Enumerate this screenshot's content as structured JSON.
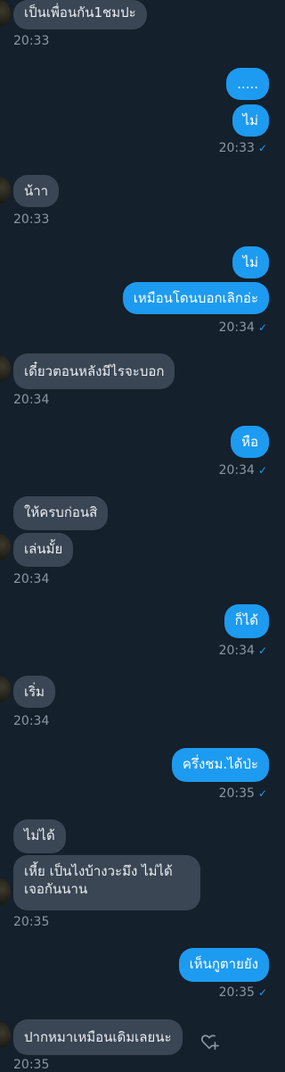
{
  "messages": [
    {
      "text": "เป็นเพื่อนกัน1ชมปะ"
    },
    {
      "text": "....."
    },
    {
      "text": "ไม่"
    },
    {
      "text": "น้าา"
    },
    {
      "text": "ไม่"
    },
    {
      "text": "เหมือนโดนบอกเลิกอ่ะ"
    },
    {
      "text": "เดี๋ยวตอนหลังมีไรจะบอก"
    },
    {
      "text": "หือ"
    },
    {
      "text": "ให้ครบก่อนสิ"
    },
    {
      "text": "เล่นมั้ย"
    },
    {
      "text": "ก็ได้"
    },
    {
      "text": "เริ่ม"
    },
    {
      "text": "ครึ่งชม.ได้ป่ะ"
    },
    {
      "text": "ไม่ได้"
    },
    {
      "text": "เหี้ย เป็นไงบ้างวะมึง ไม่ได้เจอกันนาน"
    },
    {
      "text": "เห็นกูตายยัง"
    },
    {
      "text": "ปากหมาเหมือนเดิมเลยนะ"
    }
  ],
  "times": [
    "20:33",
    "20:33",
    "20:33",
    "20:34",
    "20:34",
    "20:34",
    "20:34",
    "20:34",
    "20:34",
    "20:35",
    "20:35",
    "20:35",
    "20:35"
  ],
  "read_mark": "✓",
  "colors": {
    "background": "#14202b",
    "incoming": "#3a4654",
    "outgoing": "#1d9bf0",
    "time": "#8b98a5"
  },
  "icons": {
    "like": "heart-outline-plus-icon"
  }
}
